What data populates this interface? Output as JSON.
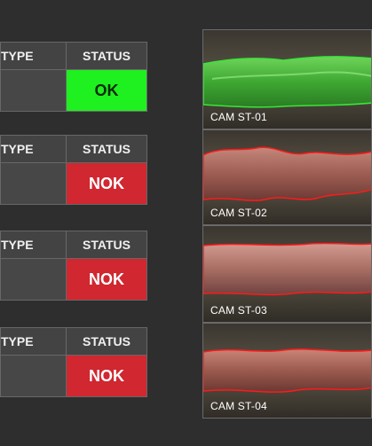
{
  "stations": [
    {
      "type_header": "TYPE",
      "status_header": "STATUS",
      "status": "OK",
      "status_class": "ok",
      "camera": "CAM ST-01"
    },
    {
      "type_header": "TYPE",
      "status_header": "STATUS",
      "status": "NOK",
      "status_class": "nok",
      "camera": "CAM ST-02"
    },
    {
      "type_header": "TYPE",
      "status_header": "STATUS",
      "status": "NOK",
      "status_class": "nok",
      "camera": "CAM ST-03"
    },
    {
      "type_header": "TYPE",
      "status_header": "STATUS",
      "status": "NOK",
      "status_class": "nok",
      "camera": "CAM ST-04"
    }
  ],
  "colors": {
    "ok": "#1ff01f",
    "nok": "#d02730",
    "ok_outline": "#39e639",
    "nok_outline": "#ff1a1a"
  }
}
